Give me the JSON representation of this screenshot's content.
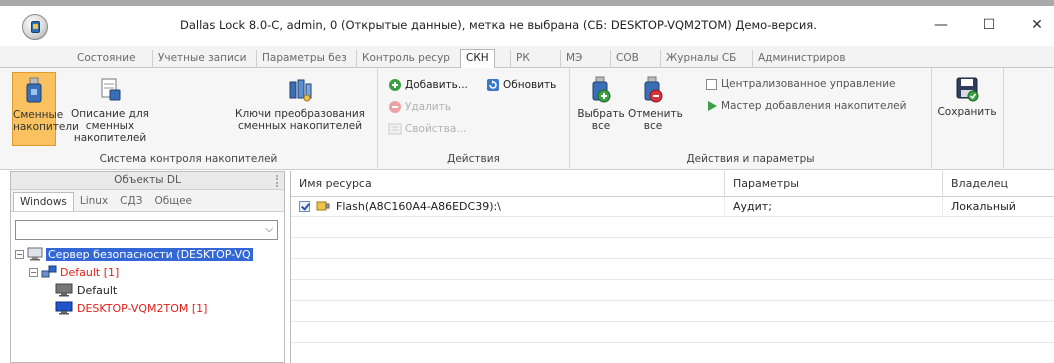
{
  "window": {
    "title": "Dallas Lock 8.0-C, admin, 0 (Открытые данные), метка не выбрана (СБ: DESKTOP-VQM2TOM) Демо-версия.",
    "minimize": "—",
    "maximize": "☐",
    "close": "✕"
  },
  "tabs": [
    {
      "label": "Состояние"
    },
    {
      "label": "Учетные записи"
    },
    {
      "label": "Параметры без"
    },
    {
      "label": "Контроль ресур"
    },
    {
      "label": "СКН"
    },
    {
      "label": "РК"
    },
    {
      "label": "МЭ"
    },
    {
      "label": "СОВ"
    },
    {
      "label": "Журналы СБ"
    },
    {
      "label": "Администриров"
    }
  ],
  "active_tab": "СКН",
  "ribbon": {
    "group1": {
      "label": "Система контроля накопителей",
      "btn_removable": "Сменные накопители",
      "btn_description": "Описание для сменных накопителей",
      "btn_keys": "Ключи преобразования сменных накопителей"
    },
    "group2": {
      "label": "Действия",
      "add": "Добавить...",
      "refresh": "Обновить",
      "delete": "Удалить",
      "properties": "Свойства..."
    },
    "group3": {
      "label": "Действия и параметры",
      "select_all": "Выбрать все",
      "unselect_all": "Отменить все",
      "central": "Централизованное управление",
      "wizard": "Мастер добавления накопителей"
    },
    "group4": {
      "save": "Сохранить"
    }
  },
  "left_panel": {
    "header": "Объекты DL",
    "subtabs": [
      "Windows",
      "Linux",
      "СДЗ",
      "Общее"
    ],
    "combo_value": "",
    "tree": {
      "server": "Сервер безопасности (DESKTOP-VQ",
      "group": "Default [1]",
      "child_default": "Default",
      "child_desktop": "DESKTOP-VQM2TOM [1]"
    }
  },
  "grid": {
    "columns": [
      "Имя ресурса",
      "Параметры",
      "Владелец"
    ],
    "rows": [
      {
        "name": "Flash(A8C160A4-A86EDC39):\\",
        "params": "Аудит;",
        "owner": "Локальный"
      }
    ]
  },
  "colors": {
    "selected_button": "#f9c15f",
    "tree_selection": "#3367d6",
    "red_text": "#e0201a"
  }
}
